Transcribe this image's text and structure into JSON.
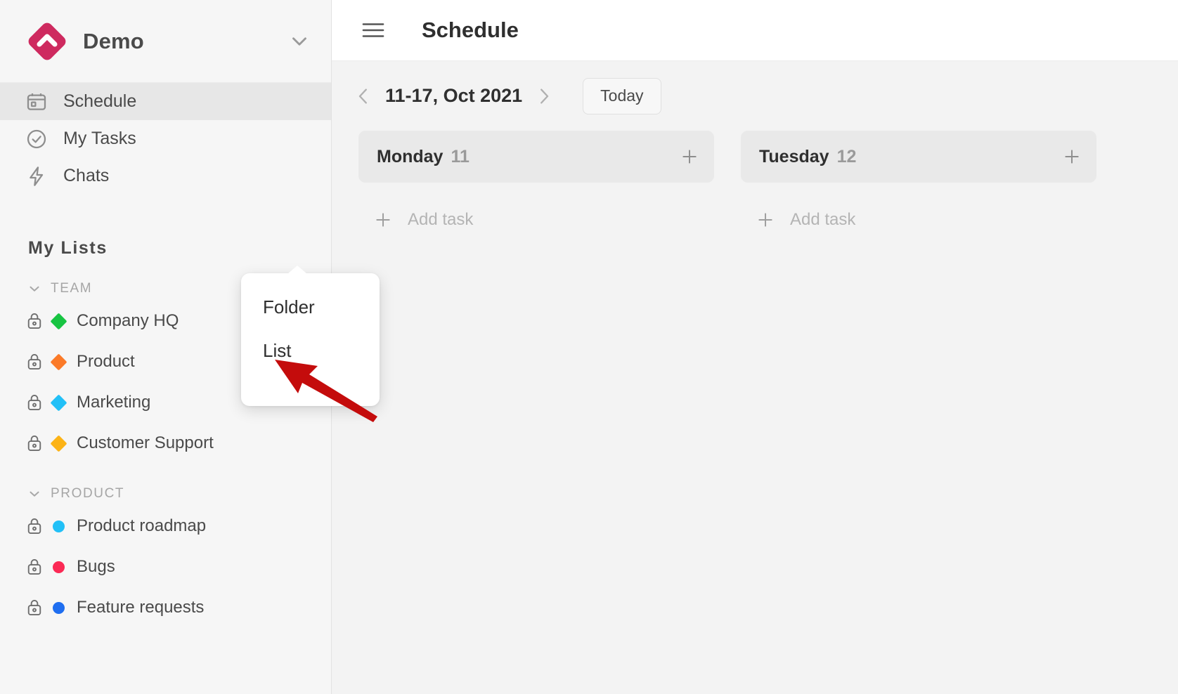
{
  "workspace": {
    "name": "Demo",
    "logo_color": "#ce2a5f",
    "caret_icon": "chevron-down-icon"
  },
  "nav": {
    "items": [
      {
        "label": "Schedule",
        "icon": "calendar-icon",
        "active": true
      },
      {
        "label": "My Tasks",
        "icon": "check-circle-icon",
        "active": false
      },
      {
        "label": "Chats",
        "icon": "lightning-bolt-icon",
        "active": false
      }
    ]
  },
  "lists": {
    "title": "My Lists",
    "groups": [
      {
        "name": "TEAM",
        "shape": "diamond",
        "items": [
          {
            "label": "Company HQ",
            "color": "#17c442",
            "locked": true
          },
          {
            "label": "Product",
            "color": "#fb7a28",
            "locked": true
          },
          {
            "label": "Marketing",
            "color": "#22c0f7",
            "locked": true
          },
          {
            "label": "Customer Support",
            "color": "#fcb316",
            "locked": true
          }
        ]
      },
      {
        "name": "PRODUCT",
        "shape": "circle",
        "items": [
          {
            "label": "Product roadmap",
            "color": "#22c0f7",
            "locked": true
          },
          {
            "label": "Bugs",
            "color": "#fb2a55",
            "locked": true
          },
          {
            "label": "Feature requests",
            "color": "#1f6ef0",
            "locked": true
          }
        ]
      }
    ]
  },
  "topbar": {
    "menu_icon": "hamburger-icon",
    "title": "Schedule"
  },
  "datebar": {
    "prev_icon": "chevron-left-icon",
    "next_icon": "chevron-right-icon",
    "range": "11-17, Oct 2021",
    "today_label": "Today"
  },
  "board": {
    "add_task_label": "Add task",
    "add_icon": "plus-icon",
    "days": [
      {
        "name": "Monday",
        "number": "11"
      },
      {
        "name": "Tuesday",
        "number": "12"
      }
    ]
  },
  "popup": {
    "items": [
      {
        "label": "Folder"
      },
      {
        "label": "List"
      }
    ]
  },
  "annotation": {
    "arrow_color": "#c40c0c",
    "points_at": "List"
  }
}
